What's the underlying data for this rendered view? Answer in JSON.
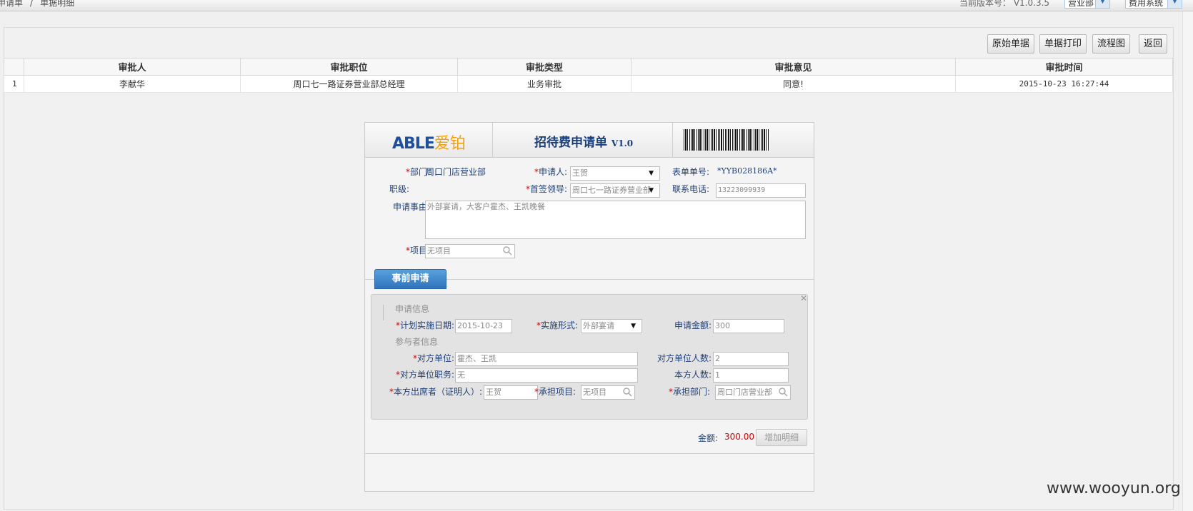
{
  "breadcrumb": {
    "parent": "申请单",
    "separator": "/",
    "current": "单据明细"
  },
  "header": {
    "version_label": "当前版本号：",
    "version_value": "V1.0.3.5",
    "dept_select": "营业部",
    "system_select": "费用系统"
  },
  "toolbar": {
    "original": "原始单据",
    "print": "单据打印",
    "flow": "流程图",
    "back": "返回"
  },
  "approvals": {
    "columns": [
      "审批人",
      "审批职位",
      "审批类型",
      "审批意见",
      "审批时间"
    ],
    "rows": [
      {
        "index": "1",
        "approver": "李献华",
        "position": "周口七一路证券营业部总经理",
        "type": "业务审批",
        "opinion": "同意!",
        "time": "2015-10-23 16:27:44"
      }
    ]
  },
  "form": {
    "logo_en": "ABLE",
    "logo_cn": "爱铂",
    "title": "招待费申请单",
    "title_version": "V1.0",
    "dept_label": "部门:",
    "dept_value": "周口门店营业部",
    "applicant_label": "申请人:",
    "applicant_value": "王贺",
    "form_no_label": "表单单号:",
    "form_no_value": "*YYB028186A*",
    "rank_label": "职级:",
    "leader_label": "首签领导:",
    "leader_value": "周口七一路证券营业部",
    "phone_label": "联系电话:",
    "phone_value": "13223099939",
    "reason_label": "申请事由:",
    "reason_value": "外部宴请，大客户霍杰、王凯晚餐",
    "project_label": "项目:",
    "project_value": "无项目",
    "tab_label": "事前申请",
    "section_apply": "申请信息",
    "plan_date_label": "计划实施日期:",
    "plan_date_value": "2015-10-23",
    "form_type_label": "实施形式:",
    "form_type_value": "外部宴请",
    "apply_amount_label": "申请金额:",
    "apply_amount_value": "300",
    "section_participants": "参与者信息",
    "party_unit_label": "对方单位:",
    "party_unit_value": "霍杰、王凯",
    "party_count_label": "对方单位人数:",
    "party_count_value": "2",
    "party_position_label": "对方单位职务:",
    "party_position_value": "无",
    "own_count_label": "本方人数:",
    "own_count_value": "1",
    "attendee_label": "本方出席者（证明人）:",
    "attendee_value": "王贺",
    "bear_project_label": "承担项目:",
    "bear_project_value": "无项目",
    "bear_dept_label": "承担部门:",
    "bear_dept_value": "周口门店营业部",
    "total_label": "金额:",
    "total_value": "300.00",
    "add_detail": "增加明细"
  },
  "watermark": "www.wooyun.org"
}
